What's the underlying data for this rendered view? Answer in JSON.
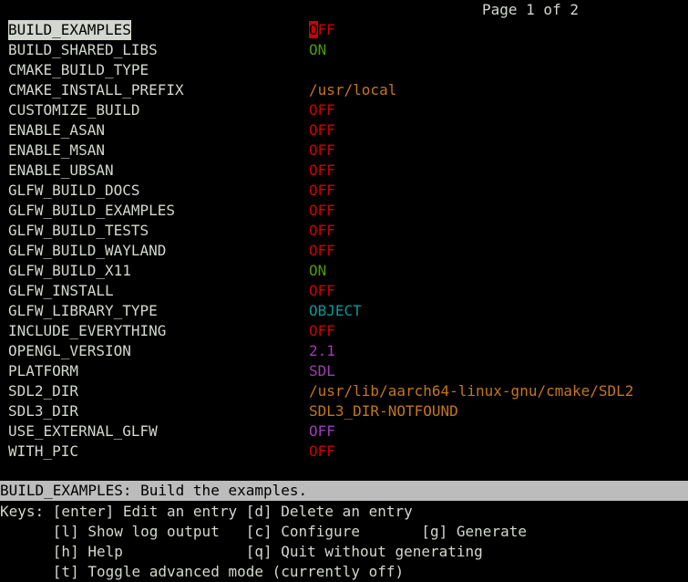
{
  "pager": "Page 1 of 2",
  "colors": {
    "off": "#cc0000",
    "on": "#4e9a06",
    "path": "#c4761c",
    "cyan": "#06989a",
    "magenta": "#a23ab6"
  },
  "entries": [
    {
      "key": "BUILD_EXAMPLES",
      "value_first": "O",
      "value_rest": "FF"
    },
    {
      "key": "BUILD_SHARED_LIBS",
      "value": "ON"
    },
    {
      "key": "CMAKE_BUILD_TYPE",
      "value": ""
    },
    {
      "key": "CMAKE_INSTALL_PREFIX",
      "value": "/usr/local"
    },
    {
      "key": "CUSTOMIZE_BUILD",
      "value": "OFF"
    },
    {
      "key": "ENABLE_ASAN",
      "value": "OFF"
    },
    {
      "key": "ENABLE_MSAN",
      "value": "OFF"
    },
    {
      "key": "ENABLE_UBSAN",
      "value": "OFF"
    },
    {
      "key": "GLFW_BUILD_DOCS",
      "value": "OFF"
    },
    {
      "key": "GLFW_BUILD_EXAMPLES",
      "value": "OFF"
    },
    {
      "key": "GLFW_BUILD_TESTS",
      "value": "OFF"
    },
    {
      "key": "GLFW_BUILD_WAYLAND",
      "value": "OFF"
    },
    {
      "key": "GLFW_BUILD_X11",
      "value": "ON"
    },
    {
      "key": "GLFW_INSTALL",
      "value": "OFF"
    },
    {
      "key": "GLFW_LIBRARY_TYPE",
      "value": "OBJECT"
    },
    {
      "key": "INCLUDE_EVERYTHING",
      "value": "OFF"
    },
    {
      "key": "OPENGL_VERSION",
      "value": "2.1"
    },
    {
      "key": "PLATFORM",
      "value": "SDL"
    },
    {
      "key": "SDL2_DIR",
      "value": "/usr/lib/aarch64-linux-gnu/cmake/SDL2"
    },
    {
      "key": "SDL3_DIR",
      "value": "SDL3_DIR-NOTFOUND"
    },
    {
      "key": "USE_EXTERNAL_GLFW",
      "value": "OFF"
    },
    {
      "key": "WITH_PIC",
      "value": "OFF"
    }
  ],
  "status": "BUILD_EXAMPLES: Build the examples.",
  "help": {
    "line1": "Keys: [enter] Edit an entry [d] Delete an entry",
    "line2": "      [l] Show log output   [c] Configure       [g] Generate",
    "line3": "      [h] Help              [q] Quit without generating",
    "line4": "      [t] Toggle advanced mode (currently off)"
  }
}
